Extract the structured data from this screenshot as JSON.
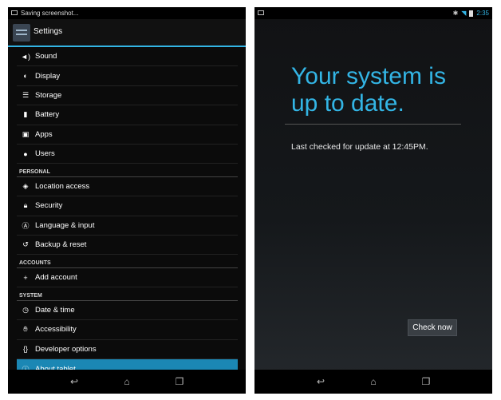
{
  "left": {
    "status": "Saving screenshot...",
    "title": "Settings",
    "items": [
      {
        "label": "Sound",
        "icon": "volume-icon"
      },
      {
        "label": "Display",
        "icon": "brightness-icon"
      },
      {
        "label": "Storage",
        "icon": "storage-icon"
      },
      {
        "label": "Battery",
        "icon": "battery-icon"
      },
      {
        "label": "Apps",
        "icon": "apps-icon"
      },
      {
        "label": "Users",
        "icon": "user-icon"
      }
    ],
    "sections": [
      "PERSONAL",
      "ACCOUNTS",
      "SYSTEM"
    ],
    "personal_items": [
      {
        "label": "Location access",
        "icon": "location-icon"
      },
      {
        "label": "Security",
        "icon": "lock-icon"
      },
      {
        "label": "Language & input",
        "icon": "language-icon"
      },
      {
        "label": "Backup & reset",
        "icon": "backup-icon"
      }
    ],
    "account_items": [
      {
        "label": "Add account",
        "icon": "plus-icon"
      }
    ],
    "system_items": [
      {
        "label": "Date & time",
        "icon": "clock-icon"
      },
      {
        "label": "Accessibility",
        "icon": "hand-icon"
      },
      {
        "label": "Developer options",
        "icon": "braces-icon"
      },
      {
        "label": "About tablet",
        "icon": "info-icon"
      }
    ],
    "selected": "About tablet"
  },
  "right": {
    "time": "2:35",
    "headline_line1": "Your system is",
    "headline_line2": "up to date.",
    "last_checked": "Last checked for update at 12:45PM.",
    "button": "Check now"
  },
  "colors": {
    "accent": "#33b5e5",
    "selected_bg": "#1b87b4"
  }
}
